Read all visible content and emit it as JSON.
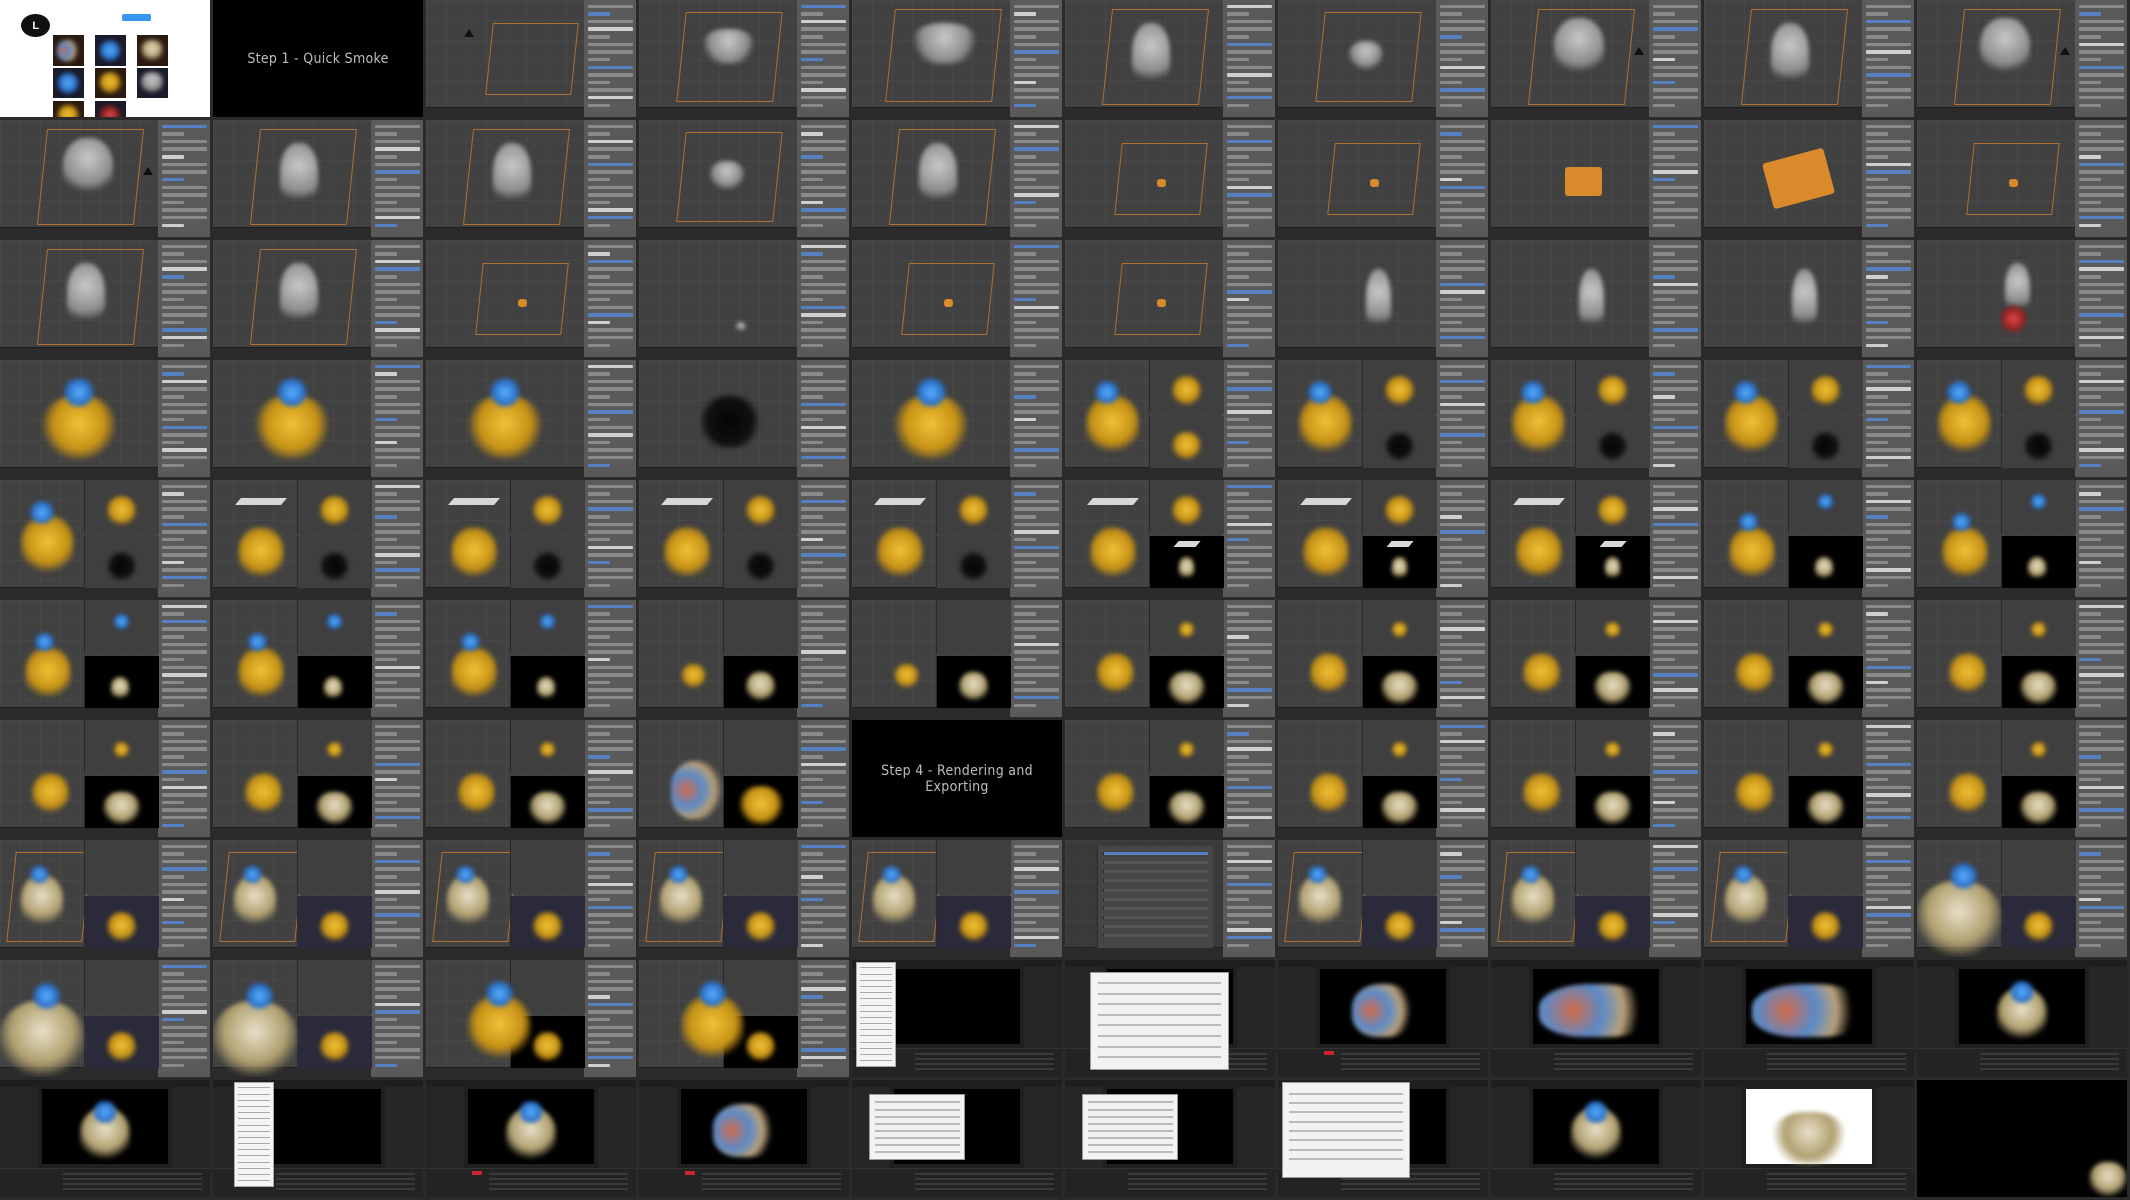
{
  "sheet": {
    "cols": 10,
    "rows": 10
  },
  "titles": {
    "step1": "Step 1 - Quick Smoke",
    "step4": "Step 4 - Rendering and Exporting"
  },
  "insta": {
    "avatar_letter": "L"
  },
  "colors": {
    "blender_bg": "#414141",
    "blender_side": "#5a5a5a",
    "accent_blue": "#5680c2",
    "domain_orange": "#b07030",
    "smoke_yellow": "#f0c238",
    "smoke_blue": "#5ab0ff",
    "ae_bg": "#1f1f1f"
  },
  "tiles": [
    {
      "kind": "insta"
    },
    {
      "kind": "title",
      "key": "step1"
    },
    {
      "kind": "blender",
      "obj": "empty-only"
    },
    {
      "kind": "blender",
      "obj": "grey-mushroom"
    },
    {
      "kind": "blender",
      "obj": "grey-mushroom-big"
    },
    {
      "kind": "blender",
      "obj": "grey-column"
    },
    {
      "kind": "blender",
      "obj": "grey-small"
    },
    {
      "kind": "blender",
      "obj": "grey-plume"
    },
    {
      "kind": "blender",
      "obj": "grey-column"
    },
    {
      "kind": "blender",
      "obj": "grey-plume"
    },
    {
      "kind": "blender",
      "obj": "grey-plume"
    },
    {
      "kind": "blender",
      "obj": "grey-column"
    },
    {
      "kind": "blender",
      "obj": "grey-column"
    },
    {
      "kind": "blender",
      "obj": "grey-small"
    },
    {
      "kind": "blender",
      "obj": "grey-column"
    },
    {
      "kind": "blender",
      "obj": "orange-dot"
    },
    {
      "kind": "blender",
      "obj": "orange-dot"
    },
    {
      "kind": "blender",
      "obj": "orange-square"
    },
    {
      "kind": "blender",
      "obj": "orange-shape"
    },
    {
      "kind": "blender",
      "obj": "orange-dot"
    },
    {
      "kind": "blender",
      "obj": "grey-column"
    },
    {
      "kind": "blender",
      "obj": "grey-column"
    },
    {
      "kind": "blender",
      "obj": "orange-dot"
    },
    {
      "kind": "blender",
      "obj": "grey-dot"
    },
    {
      "kind": "blender",
      "obj": "orange-dot"
    },
    {
      "kind": "blender",
      "obj": "orange-dot"
    },
    {
      "kind": "blender",
      "obj": "grey-thin"
    },
    {
      "kind": "blender",
      "obj": "grey-thin"
    },
    {
      "kind": "blender",
      "obj": "grey-thin"
    },
    {
      "kind": "blender",
      "obj": "red-thin"
    },
    {
      "kind": "blender",
      "obj": "yellow-blue"
    },
    {
      "kind": "blender",
      "obj": "yellow-blue"
    },
    {
      "kind": "blender",
      "obj": "yellow-blue"
    },
    {
      "kind": "blender",
      "obj": "black-smoke"
    },
    {
      "kind": "blender",
      "obj": "yellow-blue"
    },
    {
      "kind": "blender",
      "obj": "yellow-blue-split"
    },
    {
      "kind": "blender",
      "obj": "yellow-blue-split-black"
    },
    {
      "kind": "blender",
      "obj": "yellow-blue-split-black"
    },
    {
      "kind": "blender",
      "obj": "yellow-blue-split-black"
    },
    {
      "kind": "blender",
      "obj": "yellow-blue-split-black"
    },
    {
      "kind": "blender",
      "obj": "yellow-blue-split-black"
    },
    {
      "kind": "blender",
      "obj": "plane-split"
    },
    {
      "kind": "blender",
      "obj": "plane-split"
    },
    {
      "kind": "blender",
      "obj": "plane-split"
    },
    {
      "kind": "blender",
      "obj": "plane-split"
    },
    {
      "kind": "blender",
      "obj": "plane-render"
    },
    {
      "kind": "blender",
      "obj": "plane-render"
    },
    {
      "kind": "blender",
      "obj": "plane-render"
    },
    {
      "kind": "blender",
      "obj": "yellow-render"
    },
    {
      "kind": "blender",
      "obj": "yellow-render"
    },
    {
      "kind": "blender",
      "obj": "yellow-render"
    },
    {
      "kind": "blender",
      "obj": "yellow-render"
    },
    {
      "kind": "blender",
      "obj": "yellow-render"
    },
    {
      "kind": "blender",
      "obj": "dark-render"
    },
    {
      "kind": "blender",
      "obj": "dark-render"
    },
    {
      "kind": "blender",
      "obj": "cream-render"
    },
    {
      "kind": "blender",
      "obj": "cream-render"
    },
    {
      "kind": "blender",
      "obj": "cream-render"
    },
    {
      "kind": "blender",
      "obj": "cream-render"
    },
    {
      "kind": "blender",
      "obj": "cream-render"
    },
    {
      "kind": "blender",
      "obj": "cream-render"
    },
    {
      "kind": "blender",
      "obj": "cream-render"
    },
    {
      "kind": "blender",
      "obj": "cream-render"
    },
    {
      "kind": "blender",
      "obj": "multi-render"
    },
    {
      "kind": "title",
      "key": "step4"
    },
    {
      "kind": "blender",
      "obj": "cream-render"
    },
    {
      "kind": "blender",
      "obj": "cream-render"
    },
    {
      "kind": "blender",
      "obj": "cream-render"
    },
    {
      "kind": "blender",
      "obj": "cream-render"
    },
    {
      "kind": "blender",
      "obj": "cream-render"
    },
    {
      "kind": "blender",
      "obj": "domain-render"
    },
    {
      "kind": "blender",
      "obj": "domain-render"
    },
    {
      "kind": "blender",
      "obj": "domain-render"
    },
    {
      "kind": "blender",
      "obj": "domain-render"
    },
    {
      "kind": "blender",
      "obj": "domain-render"
    },
    {
      "kind": "blender",
      "obj": "settings"
    },
    {
      "kind": "blender",
      "obj": "domain-render"
    },
    {
      "kind": "blender",
      "obj": "domain-render"
    },
    {
      "kind": "blender",
      "obj": "domain-render"
    },
    {
      "kind": "blender",
      "obj": "big-smoke"
    },
    {
      "kind": "blender",
      "obj": "big-smoke"
    },
    {
      "kind": "blender",
      "obj": "big-smoke"
    },
    {
      "kind": "blender",
      "obj": "yellow-blue-render"
    },
    {
      "kind": "blender",
      "obj": "yellow-blue-render"
    },
    {
      "kind": "ae",
      "obj": "menu"
    },
    {
      "kind": "ae",
      "obj": "dialog"
    },
    {
      "kind": "ae",
      "obj": "comp-multi"
    },
    {
      "kind": "ae",
      "obj": "comp-wide"
    },
    {
      "kind": "ae",
      "obj": "comp-wide"
    },
    {
      "kind": "ae",
      "obj": "comp-cream"
    },
    {
      "kind": "ae",
      "obj": "comp-cream"
    },
    {
      "kind": "ae",
      "obj": "comp-menu"
    },
    {
      "kind": "ae",
      "obj": "comp-small"
    },
    {
      "kind": "ae",
      "obj": "comp-multi"
    },
    {
      "kind": "ae",
      "obj": "comp-dialog"
    },
    {
      "kind": "ae",
      "obj": "comp-dialog2"
    },
    {
      "kind": "ae",
      "obj": "comp-explorer"
    },
    {
      "kind": "ae",
      "obj": "comp-cream"
    },
    {
      "kind": "ae",
      "obj": "comp-white"
    },
    {
      "kind": "final"
    }
  ]
}
